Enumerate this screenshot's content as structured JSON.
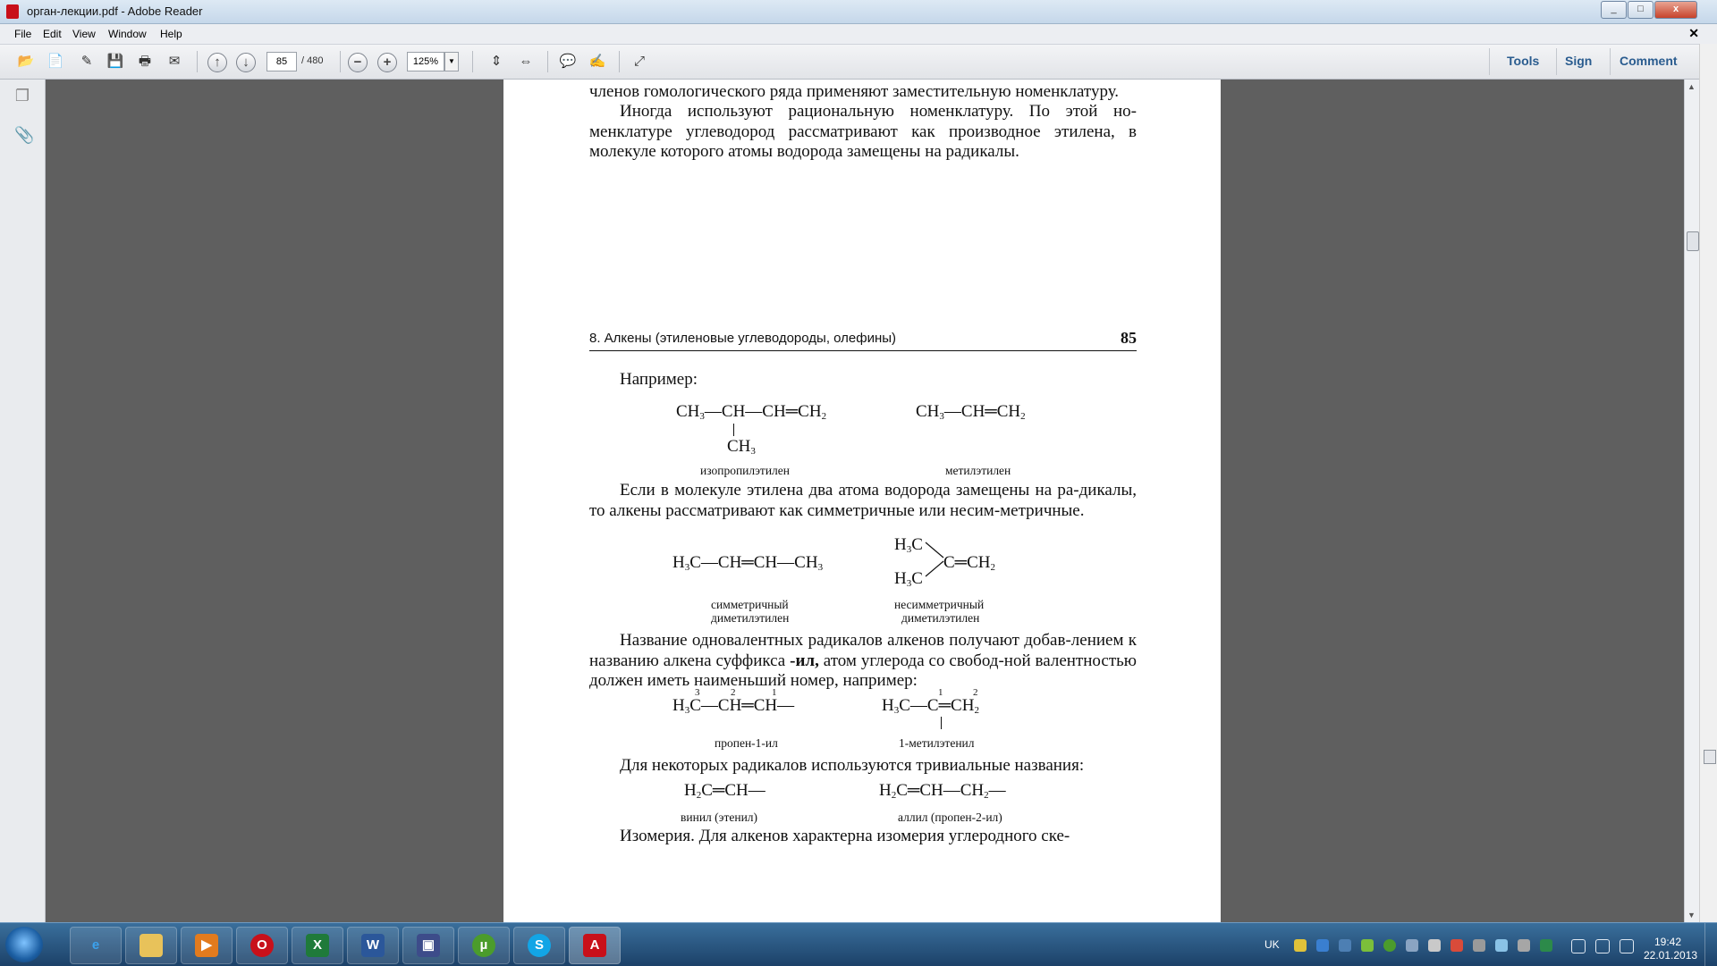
{
  "window": {
    "title": "орган-лекции.pdf - Adobe Reader"
  },
  "menu": [
    "File",
    "Edit",
    "View",
    "Window",
    "Help"
  ],
  "toolbar": {
    "page_current": "85",
    "page_total": "/ 480",
    "zoom": "125%"
  },
  "panels": {
    "tools": "Tools",
    "sign": "Sign",
    "comment": "Comment"
  },
  "document": {
    "prev_page": {
      "p1": "ребимы тривиальные названия — этилен, пропилен, для осталь-ных членов гомологического ряда применяют заместительную номенклатуру.",
      "p2": "Иногда используют рациональную номенклатуру. По этой но-менклатуре углеводород рассматривают как производное этилена, в молекуле которого атомы водорода замещены на радикалы."
    },
    "page": {
      "running_head": "8. Алкены (этиленовые углеводороды, олефины)",
      "page_number": "85",
      "example_intro": "Например:",
      "label_isopropyl": "изопропилэтилен",
      "label_methyl": "метилэтилен",
      "p_symmetric": "Если в молекуле этилена два атома водорода замещены на ра-дикалы, то алкены рассматривают как симметричные или несим-метричные.",
      "label_sym_1": "симметричный",
      "label_sym_2": "диметилэтилен",
      "label_unsym_1": "несимметричный",
      "label_unsym_2": "диметилэтилен",
      "p_radicals_1": "Название одновалентных радикалов алкенов получают добав-лением к названию алкена суффикса ",
      "suffix": "-ил,",
      "p_radicals_2": " атом углерода со свобод-ной валентностью должен иметь наименьший номер, например:",
      "label_propenyl": "пропен-1-ил",
      "label_methylethenyl": "1-метилэтенил",
      "p_trivial": "Для некоторых радикалов используются тривиальные названия:",
      "label_vinyl": "винил (этенил)",
      "label_allyl": "аллил (пропен-2-ил)",
      "cut_line": "Изомерия. Для алкенов характерна изомерия углеродного ске-"
    }
  },
  "taskbar": {
    "lang": "UK",
    "time": "19:42",
    "date": "22.01.2013",
    "apps": [
      "internet-explorer",
      "file-explorer",
      "media-player",
      "opera",
      "excel",
      "word",
      "floppy",
      "utorrent",
      "skype",
      "adobe-reader"
    ]
  },
  "colors": {
    "page_bg": "#ffffff",
    "canvas_bg": "#5f5f5f",
    "panel_link": "#2a5c8f",
    "taskbar": "#1c4168"
  }
}
